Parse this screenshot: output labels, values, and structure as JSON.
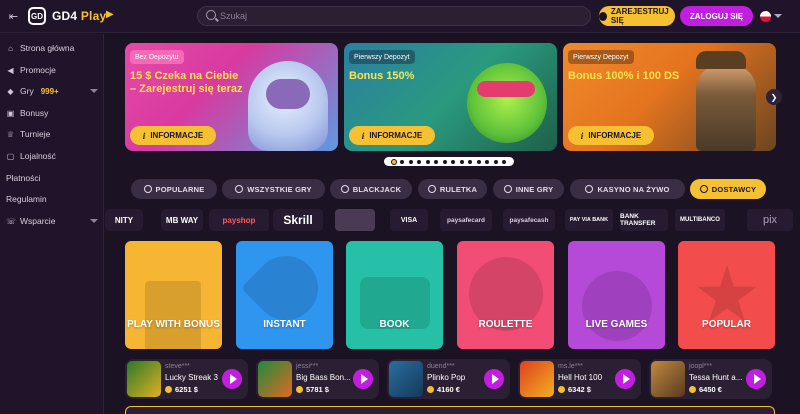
{
  "header": {
    "logo_text": "GD4",
    "logo_accent": "Play",
    "logo_mark": "GD",
    "search_placeholder": "Szukaj",
    "register_label": "ZAREJESTRUJ SIĘ",
    "login_label": "ZALOGUJ SIĘ"
  },
  "sidebar": {
    "items": [
      {
        "label": "Strona główna",
        "icon": "home-icon"
      },
      {
        "label": "Promocje",
        "icon": "megaphone-icon"
      },
      {
        "label": "Gry",
        "badge": "999+",
        "icon": "game-icon"
      },
      {
        "label": "Bonusy",
        "icon": "gift-icon"
      },
      {
        "label": "Turnieje",
        "icon": "trophy-icon"
      },
      {
        "label": "Lojalność",
        "icon": "loyalty-icon"
      },
      {
        "label": "Płatności"
      },
      {
        "label": "Regulamin"
      },
      {
        "label": "Wsparcie",
        "icon": "support-icon"
      }
    ]
  },
  "banners": [
    {
      "tag": "Bez Depozytu",
      "title": "15 $ Czeka na Ciebie – Zarejestruj się teraz",
      "button": "INFORMACJE"
    },
    {
      "tag": "Pierwszy Depozyt",
      "title": "Bonus 150%",
      "button": "INFORMACJE"
    },
    {
      "tag": "Pierwszy Depozyt",
      "title": "Bonus 100% i 100 DS",
      "button": "INFORMACJE"
    }
  ],
  "carousel": {
    "count": 14,
    "active": 0
  },
  "categories": [
    {
      "label": "POPULARNE"
    },
    {
      "label": "WSZYSTKIE GRY"
    },
    {
      "label": "BLACKJACK"
    },
    {
      "label": "RULETKA"
    },
    {
      "label": "INNE GRY"
    },
    {
      "label": "KASYNO NA ŻYWO"
    },
    {
      "label": "DOSTAWCY",
      "active": true
    }
  ],
  "payments": [
    "NITY",
    "MB WAY",
    "payshop",
    "Skrill",
    "",
    "VISA",
    "paysafecard",
    "paysafecash",
    "PAY VIA BANK",
    "BANK TRANSFER",
    "MULTIBANCO",
    "pix"
  ],
  "tiles": [
    {
      "label": "PLAY WITH BONUS",
      "color": "#f6b533"
    },
    {
      "label": "INSTANT",
      "color": "#2f96f0"
    },
    {
      "label": "BOOK",
      "color": "#25c0a5"
    },
    {
      "label": "ROULETTE",
      "color": "#f24e75"
    },
    {
      "label": "LIVE GAMES",
      "color": "#b54ad9"
    },
    {
      "label": "POPULAR",
      "color": "#f24c4c"
    }
  ],
  "winners": [
    {
      "user": "steve***",
      "game": "Lucky Streak 3",
      "amount": "6251 $"
    },
    {
      "user": "jessi***",
      "game": "Big Bass Bon...",
      "amount": "5781 $"
    },
    {
      "user": "duend***",
      "game": "Plinko Pop",
      "amount": "4160 €"
    },
    {
      "user": "ms.le***",
      "game": "Hell Hot 100",
      "amount": "6342 $"
    },
    {
      "user": "joopl***",
      "game": "Tessa Hunt a...",
      "amount": "6450 €"
    }
  ],
  "colors": {
    "accent": "#f6c033",
    "brand": "#c21ee0",
    "background": "#1b1224"
  }
}
